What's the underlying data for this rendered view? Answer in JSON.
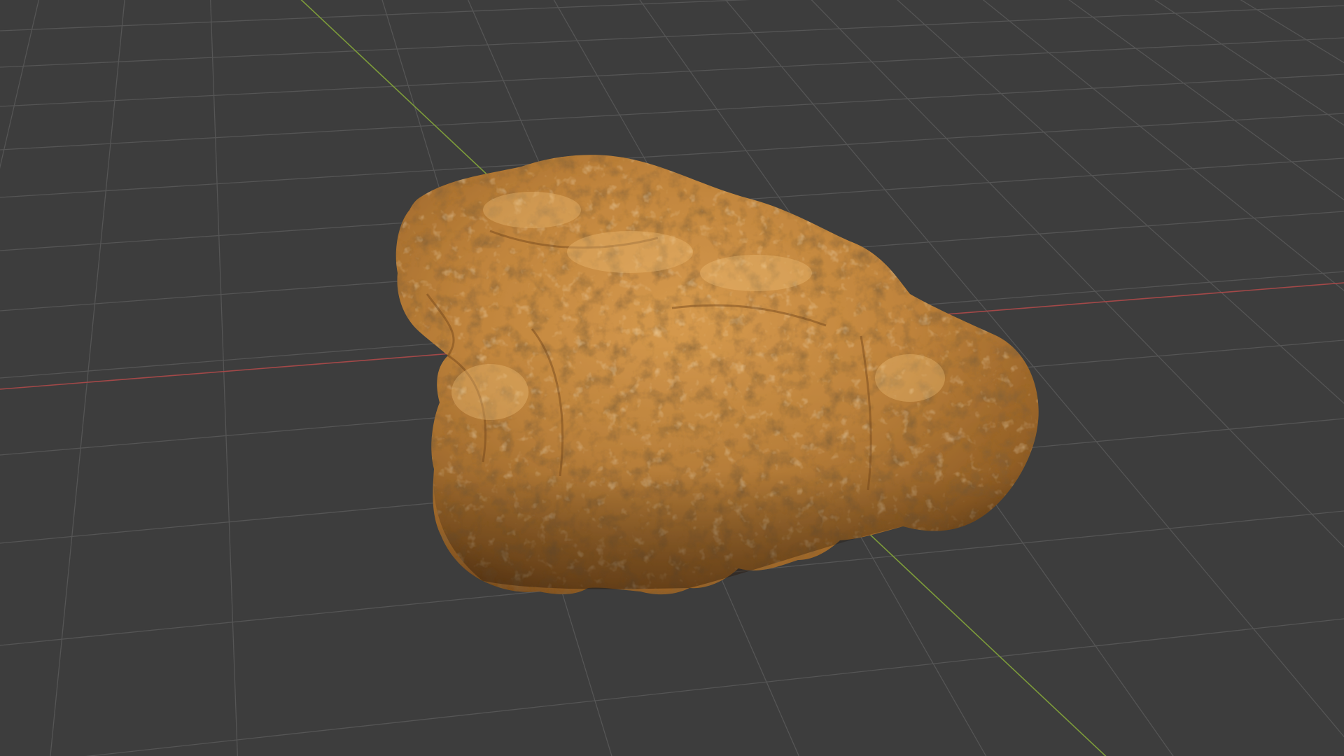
{
  "viewport": {
    "view": "3d-viewport",
    "background_color": "#3d3d3d",
    "grid_color": "#545454",
    "x_axis_color": "#a34848",
    "y_axis_color": "#7d9c3a"
  },
  "scene": {
    "object": {
      "kind": "nugget-shaped-mesh",
      "base_color": "#b97a34",
      "highlight_color": "#d69a4e",
      "shadow_color": "#4a2a10"
    }
  }
}
